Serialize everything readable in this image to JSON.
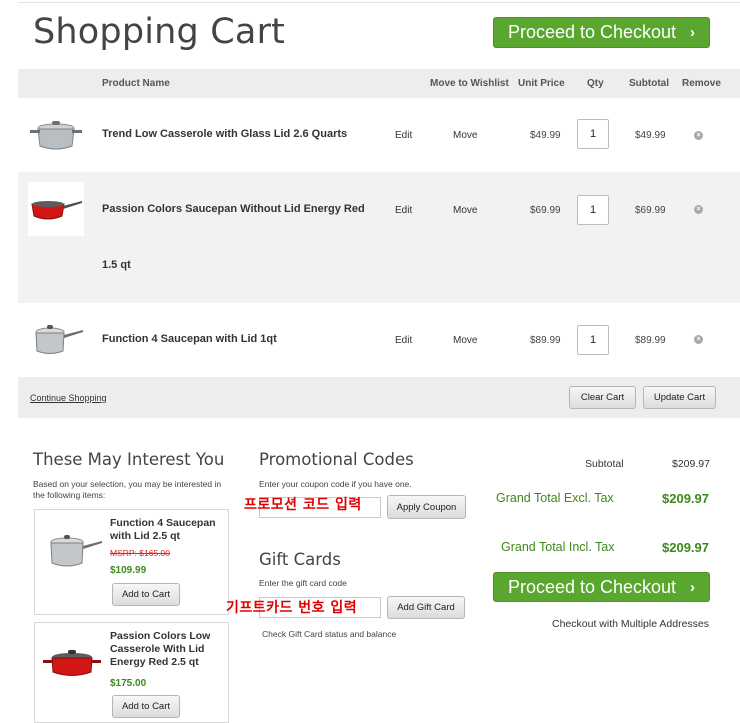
{
  "page_title": "Shopping Cart",
  "checkout_label": "Proceed to Checkout",
  "checkout_chevron": "›",
  "table": {
    "headers": {
      "product_name": "Product Name",
      "move_to_wishlist": "Move to Wishlist",
      "unit_price": "Unit Price",
      "qty": "Qty",
      "subtotal": "Subtotal",
      "remove": "Remove"
    },
    "rows": [
      {
        "name": "Trend Low Casserole with Glass Lid 2.6 Quarts",
        "edit": "Edit",
        "move": "Move",
        "price": "$49.99",
        "qty": "1",
        "subtotal": "$49.99"
      },
      {
        "name": "Passion Colors Saucepan Without Lid Energy Red",
        "name_line2": "1.5 qt",
        "edit": "Edit",
        "move": "Move",
        "price": "$69.99",
        "qty": "1",
        "subtotal": "$69.99"
      },
      {
        "name": "Function 4 Saucepan with Lid 1qt",
        "edit": "Edit",
        "move": "Move",
        "price": "$89.99",
        "qty": "1",
        "subtotal": "$89.99"
      }
    ]
  },
  "actions": {
    "continue_shopping": "Continue Shopping",
    "clear_cart": "Clear Cart",
    "update_cart": "Update Cart"
  },
  "interest": {
    "title": "These May Interest You",
    "desc": "Based on your selection, you may be interested in the following items:",
    "items": [
      {
        "name": "Function 4 Saucepan with Lid 2.5 qt",
        "msrp": "MSRP: $165.00",
        "price": "$109.99",
        "button": "Add to Cart"
      },
      {
        "name": "Passion Colors Low Casserole With Lid Energy Red 2.5 qt",
        "price": "$175.00",
        "button": "Add to Cart"
      }
    ]
  },
  "promo": {
    "title": "Promotional Codes",
    "desc": "Enter your coupon code if you have one.",
    "annotation": "프로모션 코드 입력",
    "button": "Apply Coupon"
  },
  "gift": {
    "title": "Gift Cards",
    "desc": "Enter the gift card code",
    "annotation": "기프트카드 번호 입력",
    "button": "Add Gift Card",
    "status": "Check Gift Card status and balance"
  },
  "totals": {
    "subtotal_label": "Subtotal",
    "subtotal_value": "$209.97",
    "excl_label": "Grand Total Excl. Tax",
    "excl_value": "$209.97",
    "incl_label": "Grand Total Incl. Tax",
    "incl_value": "$209.97",
    "multi_address": "Checkout with Multiple Addresses"
  },
  "colors": {
    "green": "#5aa72f",
    "price_green": "#3d8a1a",
    "msrp_red": "#d9251d",
    "annotation_red": "#e00000"
  }
}
